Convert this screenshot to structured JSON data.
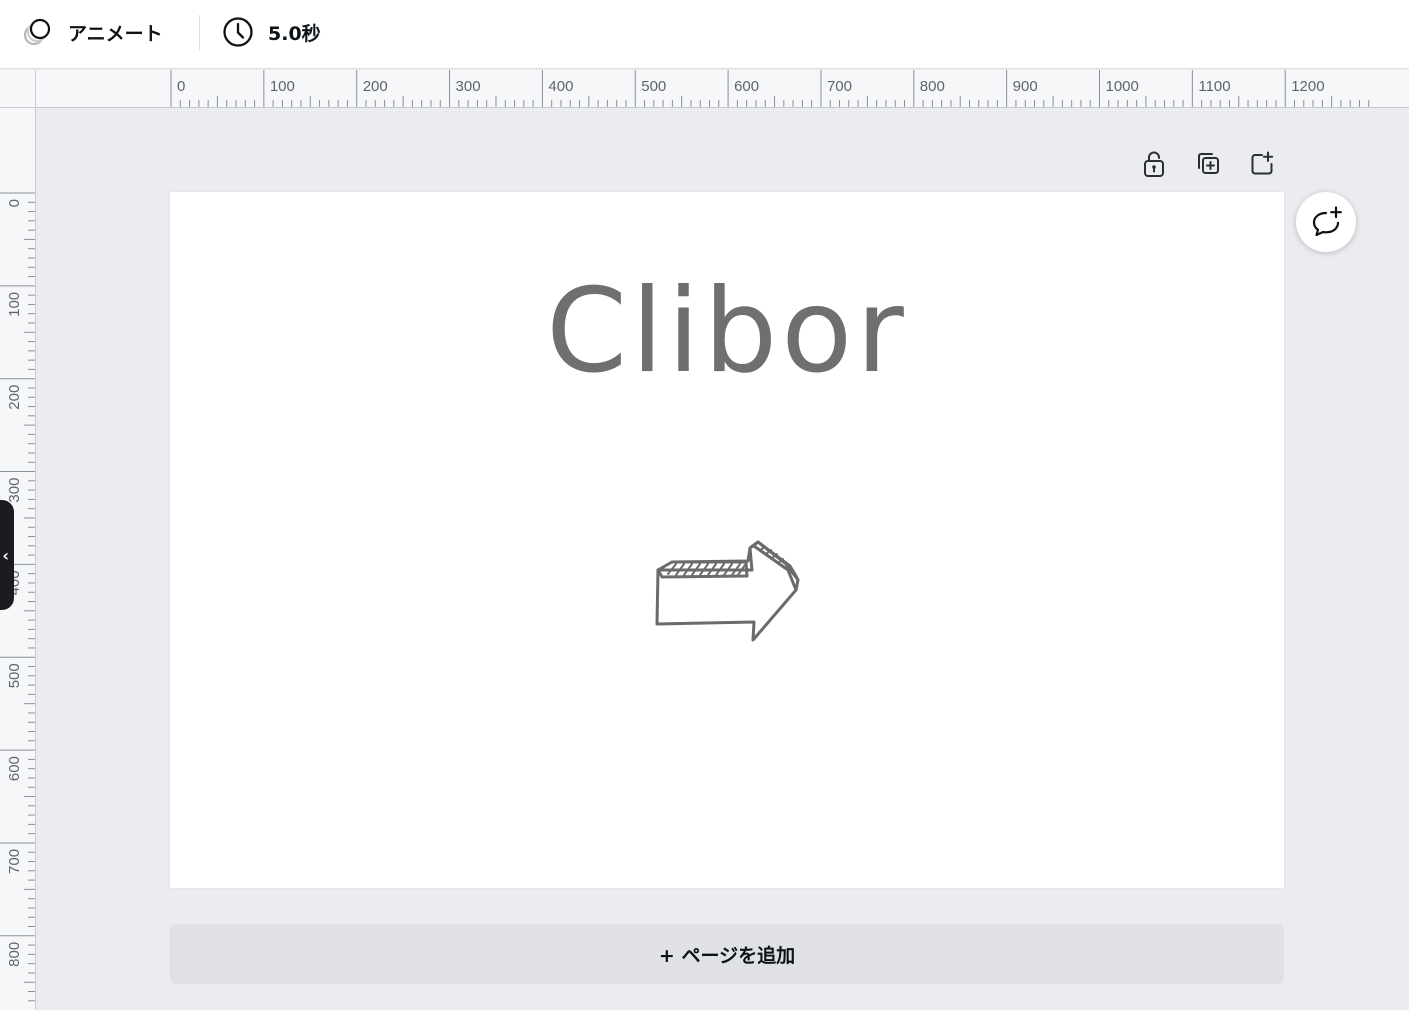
{
  "toolbar": {
    "animate_label": "アニメート",
    "duration_label": "5.0秒"
  },
  "ruler": {
    "top_labels": [
      "0",
      "100",
      "200",
      "300",
      "400",
      "500",
      "600",
      "700",
      "800",
      "900",
      "1000",
      "1100",
      "1200"
    ],
    "left_labels": [
      "0",
      "100",
      "200",
      "300",
      "400",
      "500",
      "600",
      "700",
      "800"
    ]
  },
  "canvas": {
    "title_text": "Clibor",
    "title_color": "#6f6f6f",
    "background": "#ffffff"
  },
  "page_actions": {
    "lock_icon": "unlock-icon",
    "duplicate_icon": "duplicate-page-icon",
    "add_icon": "add-page-icon",
    "comment_icon": "add-comment-icon"
  },
  "add_page": {
    "label": "+ ページを追加"
  },
  "colors": {
    "workspace": "#ebecf0",
    "ruler_bg": "#f6f7f8",
    "ruler_tick": "#8a8f98"
  }
}
